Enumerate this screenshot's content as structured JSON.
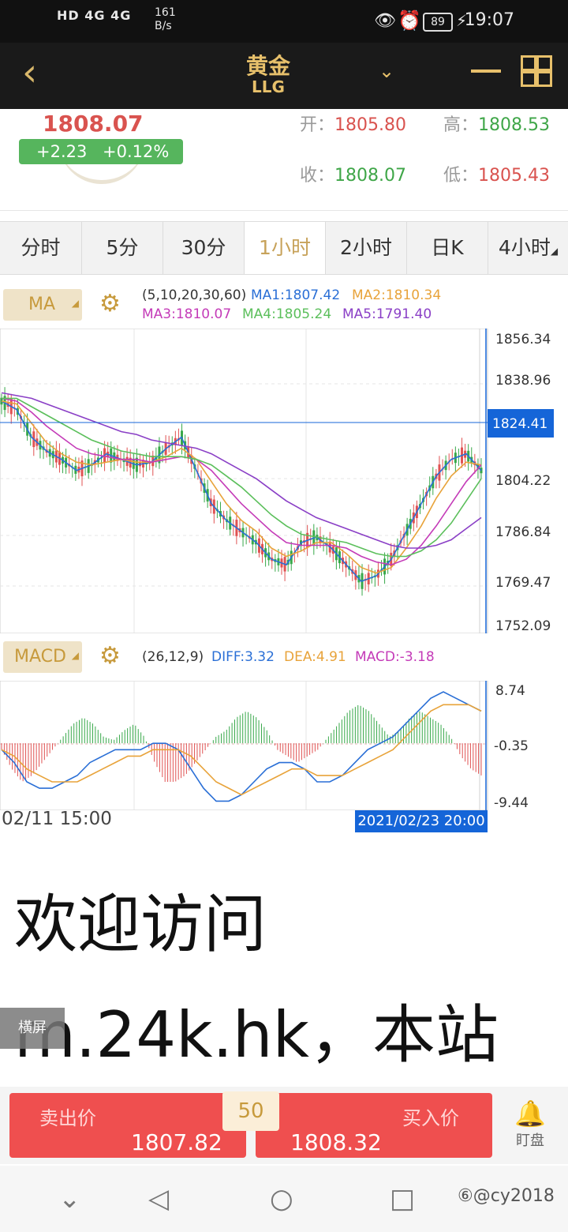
{
  "status_bar": {
    "left_icons": "HD 4G 4G",
    "speed_value": "161",
    "speed_unit": "B/s",
    "battery": "89",
    "time": "19:07"
  },
  "header": {
    "title": "黄金",
    "subtitle": "LLG"
  },
  "quote": {
    "price": "1808.07",
    "change": "+2.23",
    "change_pct": "+0.12%",
    "open_label": "开：",
    "open": "1805.80",
    "high_label": "高：",
    "high": "1808.53",
    "close_label": "收：",
    "close": "1808.07",
    "low_label": "低：",
    "low": "1805.43"
  },
  "tabs": [
    {
      "label": "分时",
      "active": false
    },
    {
      "label": "5分",
      "active": false
    },
    {
      "label": "30分",
      "active": false
    },
    {
      "label": "1小时",
      "active": true
    },
    {
      "label": "2小时",
      "active": false
    },
    {
      "label": "日K",
      "active": false
    },
    {
      "label": "4小时",
      "active": false
    }
  ],
  "ma": {
    "button": "MA",
    "params": "(5,10,20,30,60)",
    "ma1": "MA1:1807.42",
    "ma2": "MA2:1810.34",
    "ma3": "MA3:1810.07",
    "ma4": "MA4:1805.24",
    "ma5": "MA5:1791.40"
  },
  "macd": {
    "button": "MACD",
    "params": "(26,12,9)",
    "diff": "DIFF:3.32",
    "dea": "DEA:4.91",
    "macd": "MACD:-3.18"
  },
  "colors": {
    "ma1": "#2a6fd6",
    "ma2": "#e8a33a",
    "ma3": "#c43bb8",
    "ma4": "#5bbf5b",
    "ma5": "#8a3fc6",
    "up": "#e05252",
    "down": "#38a84a",
    "gold": "#c79a3c",
    "crosshair": "#1565d8"
  },
  "chart_data": [
    {
      "type": "candlestick",
      "y_ticks": [
        "1856.34",
        "1838.96",
        "1804.22",
        "1786.84",
        "1769.47",
        "1752.09"
      ],
      "ylim": [
        1752.09,
        1856.34
      ],
      "crosshair_value": "1824.41",
      "series": [
        {
          "name": "MA1",
          "values": [
            1833,
            1830,
            1820,
            1815,
            1812,
            1808,
            1810,
            1814,
            1812,
            1810,
            1811,
            1816,
            1820,
            1808,
            1796,
            1790,
            1786,
            1782,
            1776,
            1774,
            1782,
            1784,
            1780,
            1774,
            1768,
            1770,
            1776,
            1786,
            1796,
            1806,
            1812,
            1814,
            1808
          ]
        },
        {
          "name": "MA2",
          "values": [
            1833,
            1832,
            1825,
            1818,
            1814,
            1811,
            1810,
            1811,
            1812,
            1811,
            1811,
            1813,
            1816,
            1812,
            1804,
            1796,
            1790,
            1786,
            1780,
            1777,
            1779,
            1782,
            1782,
            1778,
            1773,
            1771,
            1773,
            1780,
            1788,
            1798,
            1806,
            1811,
            1810
          ]
        },
        {
          "name": "MA3",
          "values": [
            1834,
            1833,
            1829,
            1824,
            1820,
            1816,
            1814,
            1813,
            1812,
            1812,
            1811,
            1812,
            1813,
            1812,
            1808,
            1802,
            1796,
            1791,
            1786,
            1782,
            1781,
            1781,
            1781,
            1780,
            1777,
            1775,
            1774,
            1776,
            1781,
            1788,
            1796,
            1804,
            1810
          ]
        },
        {
          "name": "MA4",
          "values": [
            1834,
            1834,
            1831,
            1828,
            1825,
            1822,
            1819,
            1817,
            1815,
            1814,
            1813,
            1813,
            1813,
            1812,
            1810,
            1806,
            1802,
            1797,
            1792,
            1788,
            1785,
            1784,
            1783,
            1782,
            1780,
            1778,
            1777,
            1777,
            1779,
            1783,
            1789,
            1797,
            1805
          ]
        },
        {
          "name": "MA5",
          "values": [
            1836,
            1835,
            1834,
            1832,
            1830,
            1828,
            1826,
            1824,
            1822,
            1821,
            1819,
            1818,
            1817,
            1816,
            1814,
            1811,
            1808,
            1805,
            1801,
            1797,
            1794,
            1791,
            1789,
            1787,
            1785,
            1783,
            1781,
            1780,
            1780,
            1781,
            1783,
            1787,
            1791
          ]
        }
      ]
    },
    {
      "type": "bar",
      "y_ticks": [
        "8.74",
        "-0.35",
        "-9.44"
      ],
      "ylim": [
        -9.44,
        8.74
      ],
      "macd_values": [
        -1,
        -4,
        -6,
        -5,
        -3,
        -1,
        1,
        3,
        4,
        3,
        1,
        0.5,
        2,
        3,
        1,
        -3,
        -6,
        -6,
        -5,
        -3,
        -1,
        1,
        2,
        4,
        5,
        4,
        2,
        -1,
        -2,
        -3,
        -2,
        -1,
        1,
        3,
        5,
        6,
        5,
        3,
        1,
        2,
        4,
        5,
        4,
        3,
        1,
        -2,
        -4,
        -5
      ],
      "diff_values": [
        -1,
        -3,
        -6,
        -7,
        -7,
        -6,
        -5,
        -3,
        -2,
        -1,
        -1,
        -1,
        0,
        0,
        -1,
        -4,
        -7,
        -9,
        -9,
        -8,
        -6,
        -4,
        -3,
        -3,
        -4,
        -6,
        -6,
        -5,
        -3,
        -1,
        0,
        1,
        3,
        5,
        7,
        8,
        7,
        6,
        5
      ],
      "dea_values": [
        -1,
        -2,
        -4,
        -5,
        -6,
        -6,
        -6,
        -5,
        -4,
        -3,
        -2,
        -2,
        -1,
        -1,
        -1,
        -2,
        -4,
        -6,
        -7,
        -8,
        -7,
        -6,
        -5,
        -4,
        -4,
        -5,
        -5,
        -5,
        -4,
        -3,
        -2,
        -1,
        1,
        3,
        5,
        6,
        6,
        6,
        5
      ],
      "x_start_label": "02/11 15:00",
      "x_end_label": "2021/02/23 20:00"
    }
  ],
  "ad": {
    "line1": "欢迎访问",
    "line2": "m.24k.hk，本站",
    "landscape_label": "横屏"
  },
  "trade": {
    "sell_label": "卖出价",
    "sell_price": "1807.82",
    "spread": "50",
    "buy_label": "买入价",
    "buy_price": "1808.32",
    "watch_label": "盯盘"
  },
  "watermark": "⑥@cy2018"
}
